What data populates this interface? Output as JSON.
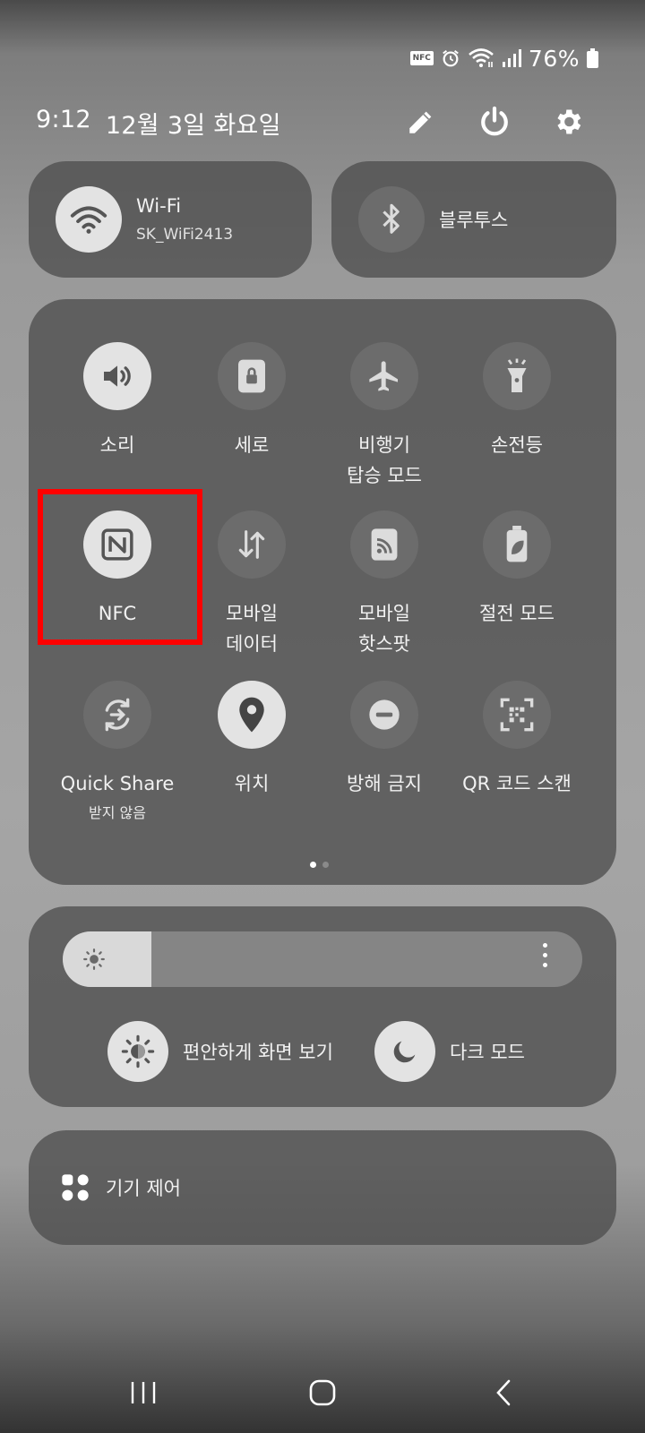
{
  "status_bar": {
    "nfc_badge": "NFC",
    "battery_percent": "76%"
  },
  "header": {
    "time": "9:12",
    "date": "12월 3일 화요일"
  },
  "connections": {
    "wifi": {
      "title": "Wi-Fi",
      "network": "SK_WiFi2413",
      "state": "on"
    },
    "bluetooth": {
      "title": "블루투스",
      "state": "off"
    }
  },
  "tiles": [
    {
      "label": "소리",
      "icon": "speaker-icon",
      "state": "on"
    },
    {
      "label": "세로",
      "icon": "rotation-lock-icon",
      "state": "off"
    },
    {
      "label": "비행기\n탑승 모드",
      "icon": "airplane-icon",
      "state": "off"
    },
    {
      "label": "손전등",
      "icon": "flashlight-icon",
      "state": "off"
    },
    {
      "label": "NFC",
      "icon": "nfc-icon",
      "state": "on"
    },
    {
      "label": "모바일\n데이터",
      "icon": "mobile-data-icon",
      "state": "off"
    },
    {
      "label": "모바일\n핫스팟",
      "icon": "hotspot-icon",
      "state": "off"
    },
    {
      "label": "절전 모드",
      "icon": "power-saving-icon",
      "state": "off"
    },
    {
      "label": "Quick Share",
      "sublabel": "받지 않음",
      "icon": "quick-share-icon",
      "state": "off"
    },
    {
      "label": "위치",
      "icon": "location-icon",
      "state": "on"
    },
    {
      "label": "방해 금지",
      "icon": "do-not-disturb-icon",
      "state": "off"
    },
    {
      "label": "QR 코드 스캔",
      "icon": "qr-scan-icon",
      "state": "off"
    }
  ],
  "pager": {
    "pages": 2,
    "current": 1
  },
  "brightness": {
    "level": 0.17,
    "eye_comfort_label": "편안하게 화면 보기",
    "dark_mode_label": "다크 모드"
  },
  "device_control": {
    "label": "기기 제어"
  },
  "colors": {
    "tile_on": "#e3e3e3",
    "tile_off": "#6c6c6c",
    "highlight": "#ff0000"
  }
}
